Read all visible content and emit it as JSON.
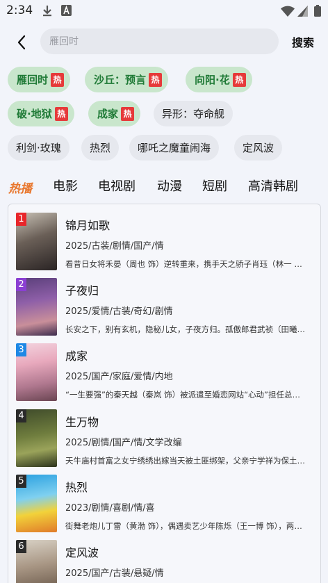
{
  "status": {
    "time": "2:34"
  },
  "search": {
    "placeholder": "雁回时",
    "button_label": "搜索"
  },
  "hot_badge": "热",
  "chips": [
    {
      "label": "雁回时",
      "hot": true
    },
    {
      "label": "沙丘：预言",
      "hot": true
    },
    {
      "label": "向阳·花",
      "hot": true
    },
    {
      "label": "破·地狱",
      "hot": true
    },
    {
      "label": "成家",
      "hot": true
    },
    {
      "label": "异形：夺命舰",
      "hot": false
    },
    {
      "label": "利剑·玫瑰",
      "hot": false
    },
    {
      "label": "热烈",
      "hot": false
    },
    {
      "label": "哪吒之魔童闹海",
      "hot": false
    },
    {
      "label": "定风波",
      "hot": false
    }
  ],
  "tabs": [
    {
      "label": "热播",
      "active": true
    },
    {
      "label": "电影",
      "active": false
    },
    {
      "label": "电视剧",
      "active": false
    },
    {
      "label": "动漫",
      "active": false
    },
    {
      "label": "短剧",
      "active": false
    },
    {
      "label": "高清韩剧",
      "active": false
    }
  ],
  "list": [
    {
      "rank": "1",
      "rank_color": "#e8262b",
      "title": "锦月如歌",
      "meta": "2025/古装/剧情/国产/情",
      "desc": "看昔日女将禾晏（周也 饰）逆转重来，携手天之骄子肖珏（林一 饰）"
    },
    {
      "rank": "2",
      "rank_color": "#8b3fd3",
      "title": "子夜归",
      "meta": "2025/爱情/古装/奇幻/剧情",
      "desc": "长安之下，别有玄机，隐秘儿女，子夜方归。孤傲郎君武祯（田曦薇 饰）"
    },
    {
      "rank": "3",
      "rank_color": "#1e88e5",
      "title": "成家",
      "meta": "2025/国产/家庭/爱情/内地",
      "desc": "“一生要强”的秦天越（秦岚 饰）被派遣至婚恋网站“心动”担任总经理"
    },
    {
      "rank": "4",
      "rank_color": "#2b2b2b",
      "title": "生万物",
      "meta": "2025/剧情/国产/情/文学改编",
      "desc": "天牛庙村首富之女宁绣绣出嫁当天被土匪绑架，父亲宁学祥为保土地拒付赎金"
    },
    {
      "rank": "5",
      "rank_color": "#2b2b2b",
      "title": "热烈",
      "meta": "2023/剧情/喜剧/情/喜",
      "desc": "街舞老炮儿丁雷（黄渤 饰），偶遇卖艺少年陈烁（王一博 饰），两人组队"
    },
    {
      "rank": "6",
      "rank_color": "#2b2b2b",
      "title": "定风波",
      "meta": "2025/国产/古装/悬疑/情",
      "desc": ""
    }
  ]
}
